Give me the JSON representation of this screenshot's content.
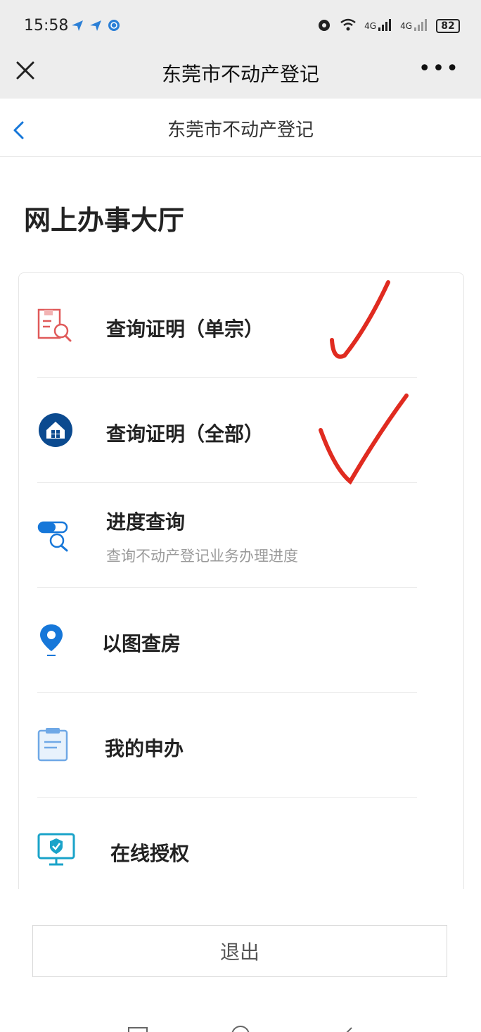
{
  "status_bar": {
    "time": "15:58",
    "battery": "82",
    "network_labels": [
      "4G",
      "4G"
    ],
    "icons": [
      "send-icon",
      "send-icon",
      "globe-icon",
      "alarm-icon",
      "wifi-icon",
      "signal-icon",
      "signal-icon",
      "battery-icon"
    ]
  },
  "title_bar": {
    "title": "东莞市不动产登记",
    "more_label": "•••",
    "icons": [
      "close-icon",
      "more-icon"
    ]
  },
  "nav": {
    "title": "东莞市不动产登记",
    "icons": [
      "back-icon"
    ]
  },
  "page": {
    "heading": "网上办事大厅"
  },
  "menu": {
    "items": [
      {
        "label": "查询证明（单宗）",
        "subtitle": "",
        "icon": "document-search-icon",
        "checked": true
      },
      {
        "label": "查询证明（全部）",
        "subtitle": "",
        "icon": "house-icon",
        "checked": true
      },
      {
        "label": "进度查询",
        "subtitle": "查询不动产登记业务办理进度",
        "icon": "progress-search-icon",
        "checked": false
      },
      {
        "label": "以图查房",
        "subtitle": "",
        "icon": "map-pin-icon",
        "checked": false
      },
      {
        "label": "我的申办",
        "subtitle": "",
        "icon": "clipboard-icon",
        "checked": false
      },
      {
        "label": "在线授权",
        "subtitle": "",
        "icon": "monitor-shield-icon",
        "checked": false
      }
    ]
  },
  "footer": {
    "logout_label": "退出"
  },
  "colors": {
    "accent_blue": "#1677d9",
    "dark_blue": "#0b4a8f",
    "icon_red": "#e05a5a",
    "check_red": "#e02b20",
    "header_gray": "#ededed"
  }
}
